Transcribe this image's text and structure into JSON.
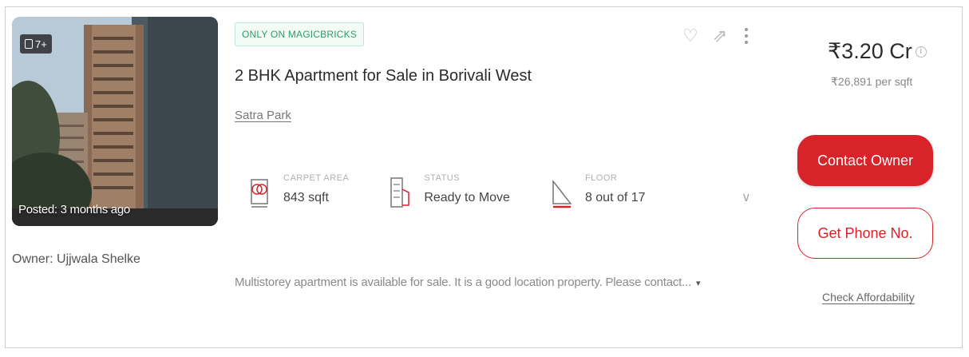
{
  "listing": {
    "photo_count": "7+",
    "posted": "Posted: 3 months ago",
    "owner": "Owner: Ujjwala Shelke",
    "badge": "ONLY ON MAGICBRICKS",
    "title": "2 BHK Apartment for Sale in Borivali West",
    "locality": "Satra Park",
    "summary": [
      {
        "label": "CARPET AREA",
        "value": "843 sqft",
        "icon": "area-icon"
      },
      {
        "label": "STATUS",
        "value": "Ready to Move",
        "icon": "status-icon"
      },
      {
        "label": "FLOOR",
        "value": "8 out of 17",
        "icon": "floor-icon"
      }
    ],
    "description": "Multistorey apartment is available for sale. It is a good location property. Please contact...",
    "more_glyph": "▾",
    "expand_glyph": "∨",
    "price": "₹3.20 Cr",
    "price_info": "i",
    "price_per_sqft": "₹26,891 per sqft",
    "contact_owner": "Contact Owner",
    "get_phone": "Get Phone No.",
    "check_affordability": "Check Affordability"
  },
  "icons": {
    "favorite": "♡",
    "share": "⇗"
  },
  "colors": {
    "accent": "#d8232a",
    "badge_text": "#2f9a6d",
    "badge_bg": "#f3fbf7"
  }
}
